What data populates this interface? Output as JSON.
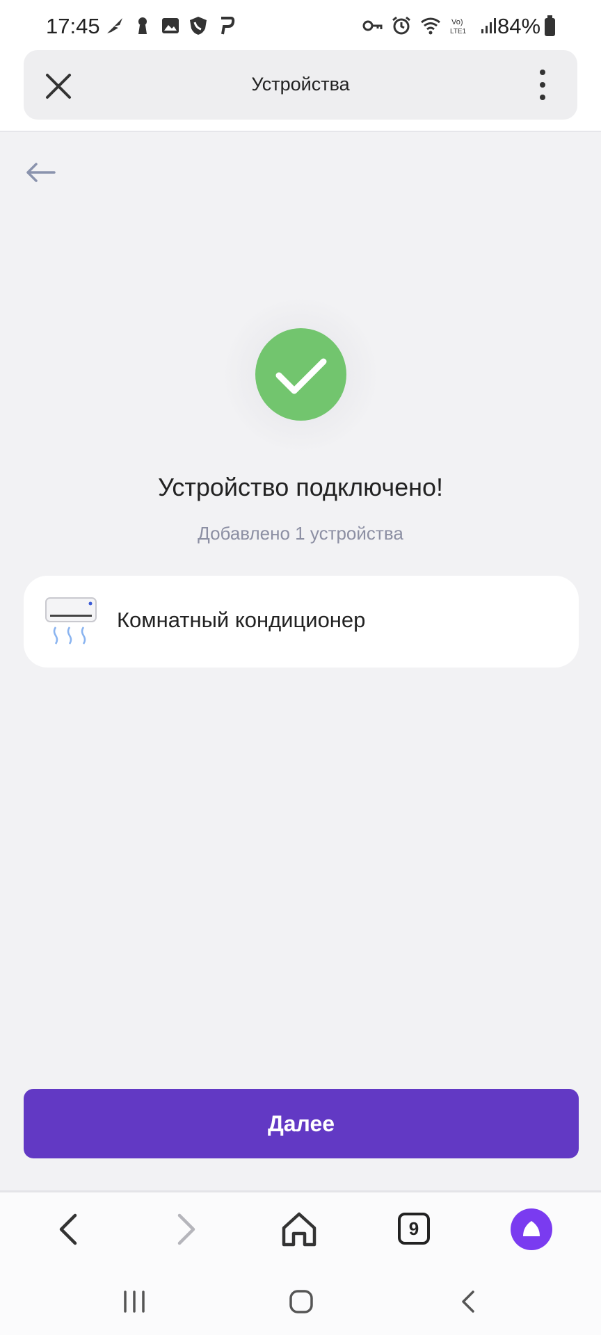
{
  "status_bar": {
    "time": "17:45",
    "battery": "84%",
    "left_icons": [
      "feather-icon",
      "keyhole-icon",
      "image-icon",
      "shield-call-icon",
      "p-icon"
    ],
    "right_icons": [
      "key-icon",
      "alarm-icon",
      "wifi-icon",
      "volte-icon",
      "signal-icon"
    ]
  },
  "header": {
    "title": "Устройства",
    "close_icon": "close-icon",
    "menu_icon": "more-vertical-icon"
  },
  "main": {
    "back_icon": "arrow-left-icon",
    "success_icon": "checkmark-icon",
    "success_color": "#72c56e",
    "title": "Устройство подключено!",
    "subtitle": "Добавлено 1 устройства",
    "device": {
      "name": "Комнатный кондиционер",
      "icon": "air-conditioner-icon"
    },
    "next_button": "Далее",
    "accent_color": "#6239c4"
  },
  "browser_bar": {
    "tabs_count": "9",
    "icons": [
      "back-icon",
      "forward-icon",
      "home-icon",
      "tabs-icon",
      "alice-icon"
    ]
  },
  "system_nav": {
    "icons": [
      "recent-apps-icon",
      "home-circle-icon",
      "back-chevron-icon"
    ]
  }
}
